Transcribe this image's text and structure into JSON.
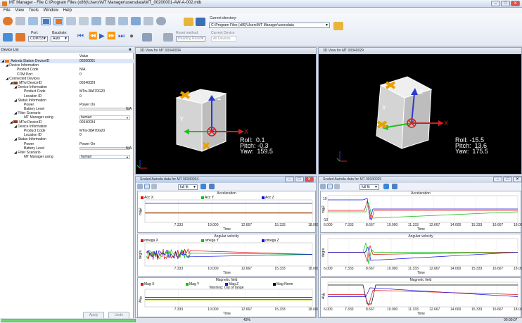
{
  "window": {
    "title": "MT Manager - File C:\\Program Files (x86)\\Users\\MT Manager\\usersdata\\MT_00200001-AW-A-002.mtb",
    "minimize": "–",
    "maximize": "□",
    "close": "✕"
  },
  "menu": [
    "File",
    "View",
    "Tools",
    "Window",
    "Help"
  ],
  "toolbar": {
    "port_label": "Port:",
    "port_value": "COM 53",
    "baudrate_label": "Baudrate:",
    "baudrate_value": "Auto",
    "current_directory_label": "Current directory:",
    "current_directory_value": "C:\\Program Files (x86)\\Users\\MT Manager\\usersdata",
    "reset_method_label": "Reset method",
    "reset_method_value": "Heading Reset",
    "current_device_label": "Current Device",
    "current_device_value": "All Devices"
  },
  "device_list": {
    "title": "Device List",
    "value_header": "Value",
    "rows": [
      {
        "key": "Awinda Station DeviceID",
        "value": "00200001",
        "indent": 2,
        "hl": true,
        "icon": "station"
      },
      {
        "key": "Device Information",
        "value": "",
        "indent": 8
      },
      {
        "key": "Product Code",
        "value": "N/A",
        "indent": 24
      },
      {
        "key": "COM Port",
        "value": "0",
        "indent": 24
      },
      {
        "key": "Connected Devices",
        "value": "",
        "indent": 8
      },
      {
        "key": "MTw DeviceID",
        "value": "00340029",
        "indent": 14,
        "icon": "mtw"
      },
      {
        "key": "Device Information",
        "value": "",
        "indent": 20
      },
      {
        "key": "Product Code",
        "value": "MTw-38A70G20",
        "indent": 34
      },
      {
        "key": "Location ID",
        "value": "0",
        "indent": 34
      },
      {
        "key": "Status Information",
        "value": "",
        "indent": 20
      },
      {
        "key": "Power",
        "value": "Power On",
        "indent": 34
      },
      {
        "key": "Battery Level",
        "value": "",
        "indent": 34,
        "battery": "N/A"
      },
      {
        "key": "Filter Scenario",
        "value": "",
        "indent": 20
      },
      {
        "key": "MT Manager using",
        "value": "human",
        "indent": 34,
        "dropdown": true
      },
      {
        "key": "MTw DeviceID",
        "value": "00340034",
        "indent": 14,
        "icon": "mtw"
      },
      {
        "key": "Device Information",
        "value": "",
        "indent": 20
      },
      {
        "key": "Product Code",
        "value": "MTw-38A70G20",
        "indent": 34
      },
      {
        "key": "Location ID",
        "value": "0",
        "indent": 34
      },
      {
        "key": "Status Information",
        "value": "",
        "indent": 20
      },
      {
        "key": "Power",
        "value": "Power On",
        "indent": 34
      },
      {
        "key": "Battery Level",
        "value": "",
        "indent": 34,
        "battery": "N/A"
      },
      {
        "key": "Filter Scenario",
        "value": "",
        "indent": 20
      },
      {
        "key": "MT Manager using",
        "value": "human",
        "indent": 34,
        "dropdown": true
      }
    ],
    "apply_label": "Apply",
    "undo_label": "Undo"
  },
  "view3d_left": {
    "title": "3D View for MT 00340034",
    "roll_label": "Roll",
    "roll": "0.1",
    "pitch_label": "Pitch",
    "pitch": "-0.3",
    "yaw_label": "Yaw",
    "yaw": "159.5"
  },
  "view3d_right": {
    "title": "3D View for MT 00340029",
    "roll_label": "Roll",
    "roll": "-15.5",
    "pitch_label": "Pitch",
    "pitch": "13.6",
    "yaw_label": "Yaw",
    "yaw": "175.5"
  },
  "axis_labels": {
    "x": "X",
    "y": "Y",
    "z": "Z"
  },
  "scaled_left": {
    "title": "Scaled Awinda data for MT 00340034",
    "fit": "full fit",
    "acc": {
      "title": "Acceleration",
      "legend": [
        "Acc X",
        "Acc Y",
        "Acc Z"
      ],
      "ylabel": "m/s2",
      "ytick": "5",
      "xticks": [
        "7.333",
        "10.000",
        "12.667",
        "15.333",
        "18.000"
      ],
      "xlabel": "Time"
    },
    "gyr": {
      "title": "Angular velocity",
      "legend": [
        "omega X",
        "omega Y",
        "omega Z"
      ],
      "ylabel": "deg/s",
      "xticks": [
        "7.333",
        "10.000",
        "12.667",
        "15.333",
        "18.000"
      ],
      "xlabel": "Time"
    },
    "mag": {
      "title": "Magnetic field",
      "legend": [
        "Mag X",
        "Mag Y",
        "Mag Z",
        "Mag Norm"
      ],
      "warning": "Warning: Out of range",
      "ylabel": "AU",
      "ytick": "0",
      "xticks": [
        "7.333",
        "10.000",
        "12.667",
        "15.333",
        "18.000"
      ],
      "xlabel": "Time"
    }
  },
  "scaled_right": {
    "title": "Scaled Awinda data for MT 00340029",
    "fit": "full fit",
    "acc": {
      "title": "Acceleration",
      "ylabel": "m/s2",
      "yticks": [
        "10",
        "0",
        "-10"
      ],
      "xticks": [
        "6.000",
        "7.333",
        "8.667",
        "10.000",
        "11.333",
        "12.667",
        "14.000",
        "15.333",
        "16.667",
        "18.000"
      ],
      "xlabel": "Time"
    },
    "gyr": {
      "title": "Angular velocity",
      "ylabel": "deg/s",
      "xticks": [
        "6.000",
        "7.333",
        "8.667",
        "10.000",
        "11.333",
        "12.667",
        "14.000",
        "15.333",
        "16.667",
        "18.000"
      ],
      "xlabel": "Time"
    },
    "mag": {
      "title": "Magnetic field",
      "ylabel": "AU",
      "ytick": "0",
      "xticks": [
        "6.000",
        "7.333",
        "8.667",
        "10.000",
        "11.333",
        "12.667",
        "14.000",
        "15.333",
        "16.667",
        "18.000"
      ],
      "xlabel": "Time"
    }
  },
  "status": {
    "progress_pct": "43%",
    "progress": 0.43,
    "time": "00:00:07"
  },
  "colors": {
    "x": "#e01010",
    "y": "#10c010",
    "z": "#1010e0",
    "norm": "#000000",
    "cube": "#dcdcdc",
    "marker": "#f0a000"
  }
}
